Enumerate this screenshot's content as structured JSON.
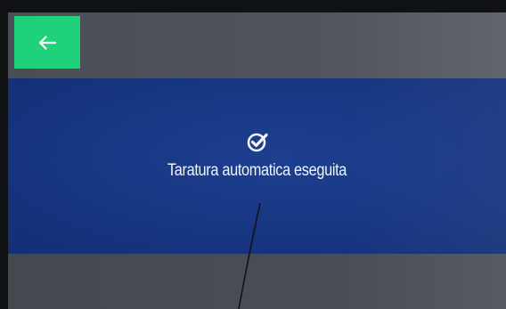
{
  "back_button": {
    "icon": "arrow-left-icon",
    "color": "#1fd179"
  },
  "status": {
    "icon": "check-circle-icon",
    "text": "Taratura automatica eseguita"
  },
  "colors": {
    "panel": "#173682",
    "bars": "#4a4d55",
    "text": "#f2f4f8"
  }
}
